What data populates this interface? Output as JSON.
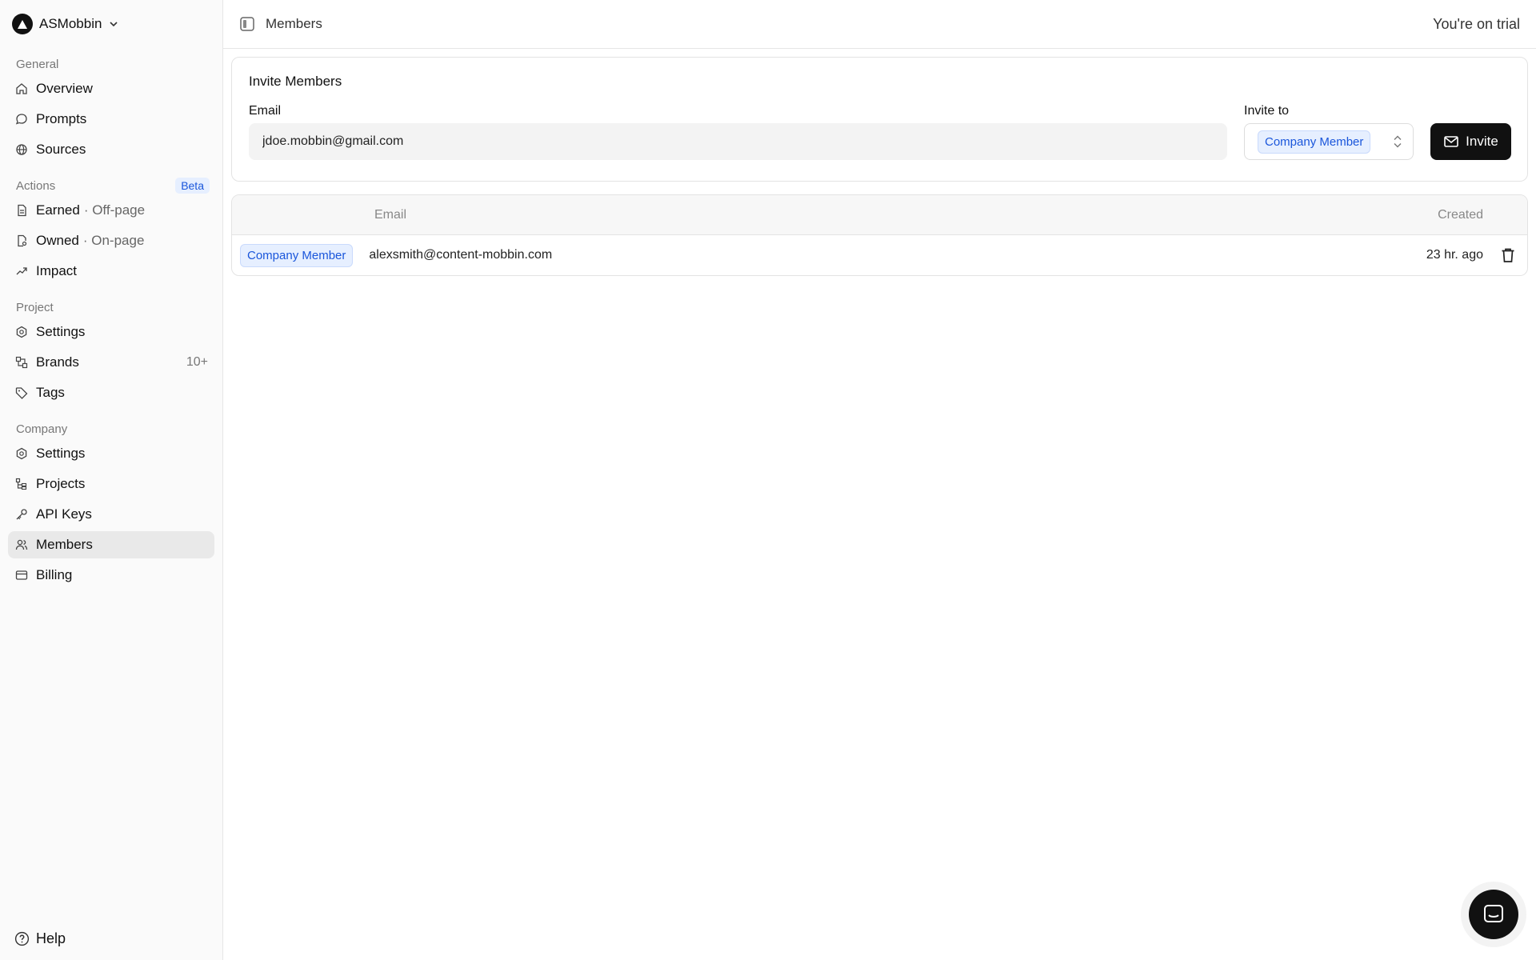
{
  "workspace": {
    "name": "ASMobbin"
  },
  "sidebar": {
    "general_label": "General",
    "general": [
      {
        "label": "Overview",
        "icon": "home-icon"
      },
      {
        "label": "Prompts",
        "icon": "chat-bubble-icon"
      },
      {
        "label": "Sources",
        "icon": "globe-icon"
      }
    ],
    "actions_label": "Actions",
    "actions_badge": "Beta",
    "actions": [
      {
        "label": "Earned",
        "sub": "· Off-page",
        "icon": "document-icon"
      },
      {
        "label": "Owned",
        "sub": "· On-page",
        "icon": "document-search-icon"
      },
      {
        "label": "Impact",
        "icon": "trend-up-icon"
      }
    ],
    "project_label": "Project",
    "project": [
      {
        "label": "Settings",
        "icon": "gear-icon"
      },
      {
        "label": "Brands",
        "count": "10+",
        "icon": "brands-icon"
      },
      {
        "label": "Tags",
        "icon": "tag-icon"
      }
    ],
    "company_label": "Company",
    "company": [
      {
        "label": "Settings",
        "icon": "gear-icon"
      },
      {
        "label": "Projects",
        "icon": "projects-icon"
      },
      {
        "label": "API Keys",
        "icon": "key-icon"
      },
      {
        "label": "Members",
        "icon": "users-icon",
        "active": true
      },
      {
        "label": "Billing",
        "icon": "credit-card-icon"
      }
    ],
    "help_label": "Help"
  },
  "topbar": {
    "breadcrumb": "Members",
    "trial_text": "You're on trial"
  },
  "invite": {
    "title": "Invite Members",
    "email_label": "Email",
    "email_value": "jdoe.mobbin@gmail.com",
    "invite_to_label": "Invite to",
    "invite_to_value": "Company Member",
    "button_label": "Invite"
  },
  "members_table": {
    "headers": {
      "email": "Email",
      "created": "Created"
    },
    "rows": [
      {
        "role": "Company Member",
        "email": "alexsmith@content-mobbin.com",
        "created": "23 hr. ago"
      }
    ]
  },
  "colors": {
    "accent": "#1a56db",
    "badge_bg": "#e6efff",
    "primary_button": "#111111"
  }
}
